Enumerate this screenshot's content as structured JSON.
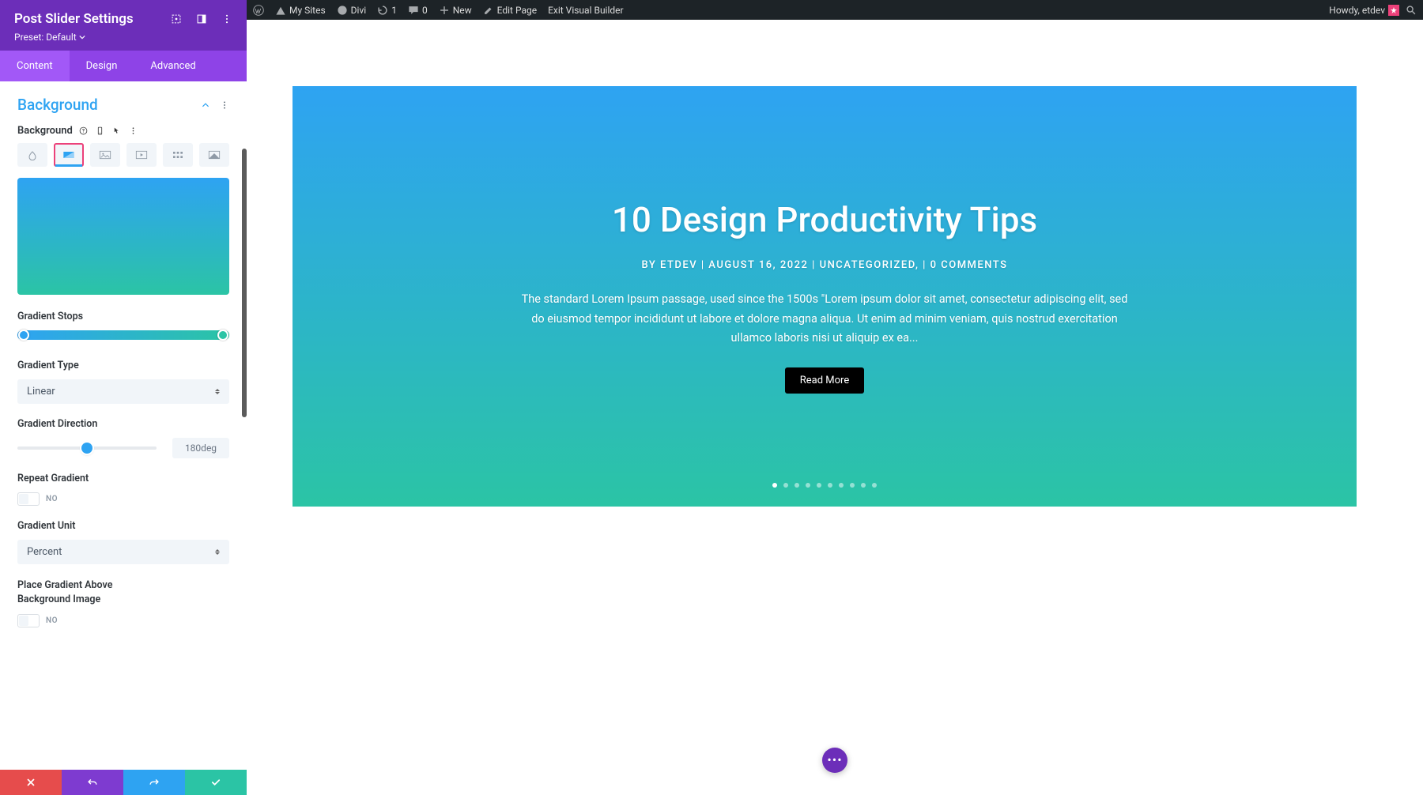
{
  "wp_bar": {
    "my_sites": "My Sites",
    "divi": "Divi",
    "revisions": "1",
    "comments": "0",
    "new": "New",
    "edit_page": "Edit Page",
    "exit_vb": "Exit Visual Builder",
    "howdy": "Howdy, etdev"
  },
  "sidebar": {
    "title": "Post Slider Settings",
    "preset_label": "Preset:",
    "preset_value": "Default",
    "tabs": [
      "Content",
      "Design",
      "Advanced"
    ],
    "active_tab": 0,
    "section_title": "Background",
    "field_bg_label": "Background",
    "gradient_stops_label": "Gradient Stops",
    "gradient_type_label": "Gradient Type",
    "gradient_type_value": "Linear",
    "gradient_direction_label": "Gradient Direction",
    "gradient_direction_value": "180deg",
    "repeat_gradient_label": "Repeat Gradient",
    "repeat_gradient_value": "NO",
    "gradient_unit_label": "Gradient Unit",
    "gradient_unit_value": "Percent",
    "place_above_label": "Place Gradient Above Background Image",
    "place_above_value": "NO"
  },
  "gradient": {
    "color_start": "#2ea3f2",
    "color_end": "#2bc4a5"
  },
  "slider": {
    "title": "10 Design Productivity Tips",
    "meta": "BY ETDEV | AUGUST 16, 2022 | UNCATEGORIZED, | 0 COMMENTS",
    "body": "The standard Lorem Ipsum passage, used since the 1500s \"Lorem ipsum dolor sit amet, consectetur adipiscing elit, sed do eiusmod tempor incididunt ut labore et dolore magna aliqua. Ut enim ad minim veniam, quis nostrud exercitation ullamco laboris nisi ut aliquip ex ea...",
    "button": "Read More",
    "dot_count": 10,
    "active_dot": 0
  }
}
